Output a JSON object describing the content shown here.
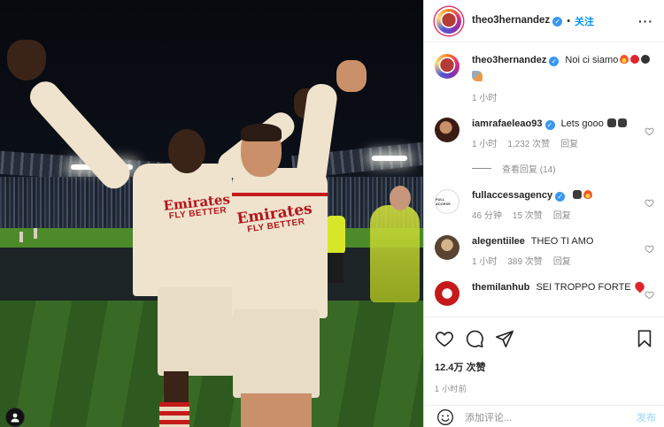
{
  "post": {
    "author": "theo3hernandez",
    "follow_label": "关注",
    "more_label": "···",
    "caption": {
      "username": "theo3hernandez",
      "text": "Noi ci siamo",
      "emojis": [
        "fire",
        "red-circle",
        "black-circle",
        "rocket"
      ],
      "time": "1 小时"
    },
    "likes": "12.4万 次赞",
    "posted_ago": "1 小时前"
  },
  "comments": [
    {
      "username": "iamrafaeleao93",
      "verified": true,
      "text": "Lets gooo",
      "emojis": [
        "devil",
        "devil"
      ],
      "time": "1 小时",
      "likes": "1,232 次赞",
      "reply": "回复",
      "view_replies": "查看回复 (14)"
    },
    {
      "username": "fullaccessagency",
      "verified": true,
      "text": "",
      "emojis": [
        "devil",
        "fire"
      ],
      "time": "46 分钟",
      "likes": "15 次赞",
      "reply": "回复"
    },
    {
      "username": "alegentiilee",
      "verified": false,
      "text": "THEO TI AMO",
      "time": "1 小时",
      "likes": "389 次赞",
      "reply": "回复"
    },
    {
      "username": "themilanhub",
      "verified": false,
      "text": "SEI TROPPO FORTE",
      "emojis": [
        "red-heart"
      ]
    }
  ],
  "photo": {
    "sponsor_left": "Emirates",
    "sponsor_left_sub": "FLY BETTER",
    "sponsor_right": "Emirates",
    "sponsor_right_sub": "FLY BETTER",
    "avatar_logo_text": "FULL ACCESS"
  },
  "add_comment": {
    "placeholder": "添加评论...",
    "post_label": "发布"
  },
  "icons": {
    "like": "heart-icon",
    "comment": "comment-icon",
    "share": "paper-plane-icon",
    "save": "bookmark-icon",
    "emoji": "smiley-icon",
    "user_tag": "person-icon"
  },
  "colors": {
    "link_blue": "#0095f6",
    "verified_blue": "#3897f0",
    "muted_gray": "#8e8e8e",
    "post_disabled": "#b2dffc",
    "milan_red": "#c51a1a"
  }
}
